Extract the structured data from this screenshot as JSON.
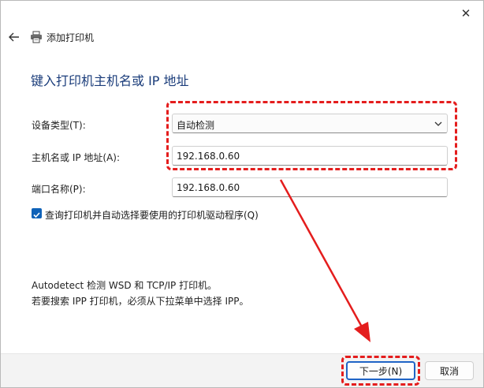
{
  "window": {
    "title": "添加打印机"
  },
  "heading": "键入打印机主机名或 IP 地址",
  "form": {
    "device_type_label": "设备类型(T):",
    "device_type_value": "自动检测",
    "host_label": "主机名或 IP 地址(A):",
    "host_value": "192.168.0.60",
    "port_label": "端口名称(P):",
    "port_value": "192.168.0.60",
    "auto_driver_label": "查询打印机并自动选择要使用的打印机驱动程序(Q)",
    "auto_driver_checked": true
  },
  "info": {
    "line1": "Autodetect 检测 WSD 和 TCP/IP 打印机。",
    "line2": "若要搜索 IPP 打印机，必须从下拉菜单中选择 IPP。"
  },
  "buttons": {
    "next": "下一步(N)",
    "cancel": "取消"
  },
  "icons": {
    "close": "close-icon",
    "back": "back-arrow-icon",
    "printer": "printer-icon",
    "chevron": "chevron-down-icon",
    "check": "checkmark-icon"
  },
  "colors": {
    "accent": "#0f62b8",
    "heading": "#1a3c7a",
    "annotation": "#e41d1d"
  }
}
